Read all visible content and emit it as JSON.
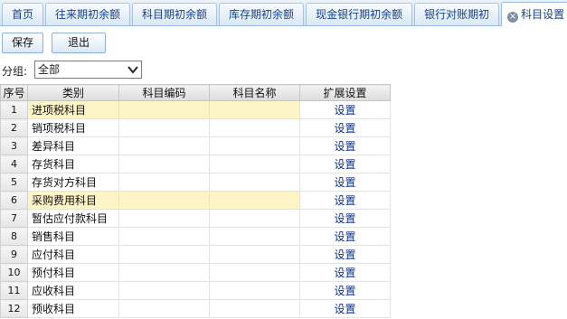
{
  "tabs": [
    {
      "label": "首页",
      "active": false
    },
    {
      "label": "往来期初余额",
      "active": false
    },
    {
      "label": "科目期初余额",
      "active": false
    },
    {
      "label": "库存期初余额",
      "active": false
    },
    {
      "label": "现金银行期初余额",
      "active": false
    },
    {
      "label": "银行对账期初",
      "active": false
    },
    {
      "label": "科目设置",
      "active": true,
      "icon": "close-icon"
    }
  ],
  "toolbar": {
    "save_label": "保存",
    "exit_label": "退出"
  },
  "filter": {
    "label": "分组:",
    "selected": "全部"
  },
  "grid": {
    "columns": [
      "序号",
      "类别",
      "科目编码",
      "科目名称",
      "扩展设置"
    ],
    "rows": [
      {
        "no": "1",
        "category": "进项税科目",
        "code": "",
        "name": "",
        "action": "设置",
        "highlighted": true
      },
      {
        "no": "2",
        "category": "销项税科目",
        "code": "",
        "name": "",
        "action": "设置",
        "highlighted": false
      },
      {
        "no": "3",
        "category": "差异科目",
        "code": "",
        "name": "",
        "action": "设置",
        "highlighted": false
      },
      {
        "no": "4",
        "category": "存货科目",
        "code": "",
        "name": "",
        "action": "设置",
        "highlighted": false
      },
      {
        "no": "5",
        "category": "存货对方科目",
        "code": "",
        "name": "",
        "action": "设置",
        "highlighted": false
      },
      {
        "no": "6",
        "category": "采购费用科目",
        "code": "",
        "name": "",
        "action": "设置",
        "highlighted": true
      },
      {
        "no": "7",
        "category": "暂估应付款科目",
        "code": "",
        "name": "",
        "action": "设置",
        "highlighted": false
      },
      {
        "no": "8",
        "category": "销售科目",
        "code": "",
        "name": "",
        "action": "设置",
        "highlighted": false
      },
      {
        "no": "9",
        "category": "应付科目",
        "code": "",
        "name": "",
        "action": "设置",
        "highlighted": false
      },
      {
        "no": "10",
        "category": "预付科目",
        "code": "",
        "name": "",
        "action": "设置",
        "highlighted": false
      },
      {
        "no": "11",
        "category": "应收科目",
        "code": "",
        "name": "",
        "action": "设置",
        "highlighted": false
      },
      {
        "no": "12",
        "category": "预收科目",
        "code": "",
        "name": "",
        "action": "设置",
        "highlighted": false
      }
    ]
  },
  "colors": {
    "tab_text": "#15428b",
    "highlight_row": "#fdf5c8",
    "link_text": "#0b2f8c"
  }
}
